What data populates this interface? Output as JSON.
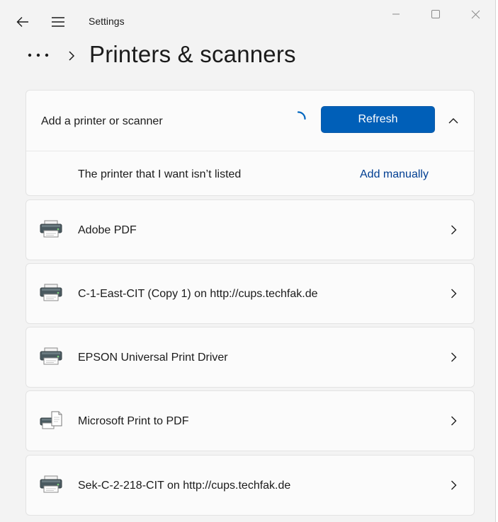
{
  "window": {
    "app_title": "Settings",
    "icons": {
      "back": "back-arrow-icon",
      "menu": "hamburger-icon",
      "minimize": "minimize-icon",
      "maximize": "maximize-icon",
      "close": "close-icon"
    }
  },
  "header": {
    "more_icon": "ellipsis-icon",
    "title": "Printers & scanners"
  },
  "add_section": {
    "label": "Add a printer or scanner",
    "refresh_label": "Refresh",
    "not_listed_label": "The printer that I want isn’t listed",
    "add_manually_label": "Add manually"
  },
  "printers": [
    {
      "name": "Adobe PDF",
      "icon": "printer-icon"
    },
    {
      "name": "C-1-East-CIT (Copy 1) on http://cups.techfak.de",
      "icon": "printer-icon"
    },
    {
      "name": "EPSON Universal Print Driver",
      "icon": "printer-icon"
    },
    {
      "name": "Microsoft Print to PDF",
      "icon": "pdf-printer-icon"
    },
    {
      "name": "Sek-C-2-218-CIT on http://cups.techfak.de",
      "icon": "printer-icon"
    }
  ],
  "colors": {
    "accent": "#005fb8",
    "link": "#003e92",
    "window_bg": "#f3f3f3",
    "card_bg": "#fbfbfb",
    "spinner": "#0067c0"
  }
}
